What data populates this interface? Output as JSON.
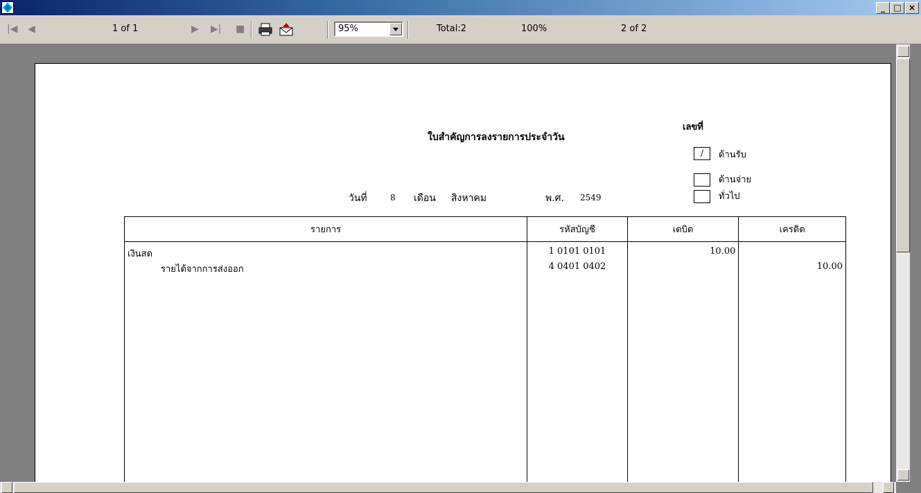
{
  "titlebar": {
    "min_label": "_",
    "max_label": "□",
    "close_label": "×"
  },
  "toolbar": {
    "first_icon": "|◀",
    "prev_icon": "◀",
    "page_indicator": "1 of 1",
    "next_icon": "▶",
    "last_icon": "▶|",
    "stop_icon": "■",
    "zoom_value": "95%",
    "total": "Total:2",
    "percent": "100%",
    "record": "2 of 2"
  },
  "report": {
    "title": "ใบสำคัญการลงรายการประจำวัน",
    "doc_no_label": "เลขที่",
    "checkboxes": [
      {
        "mark": "/",
        "label": "ด้านรับ"
      },
      {
        "mark": "",
        "label": "ด้านจ่าย"
      },
      {
        "mark": "",
        "label": "ทั่วไป"
      }
    ],
    "date": {
      "day_label": "วันที่",
      "day": "8",
      "month_label": "เดือน",
      "month": "สิงหาคม",
      "year_label": "พ.ศ.",
      "year": "2549"
    },
    "columns": [
      "รายการ",
      "รหัสบัญชี",
      "เดบิต",
      "เครดิต"
    ],
    "rows": [
      {
        "item": "เงินสด",
        "code": "1 0101 0101",
        "debit": "10.00",
        "credit": ""
      },
      {
        "item": "รายได้จากการส่งออก",
        "code": "4 0401 0402",
        "debit": "",
        "credit": "10.00"
      }
    ]
  }
}
